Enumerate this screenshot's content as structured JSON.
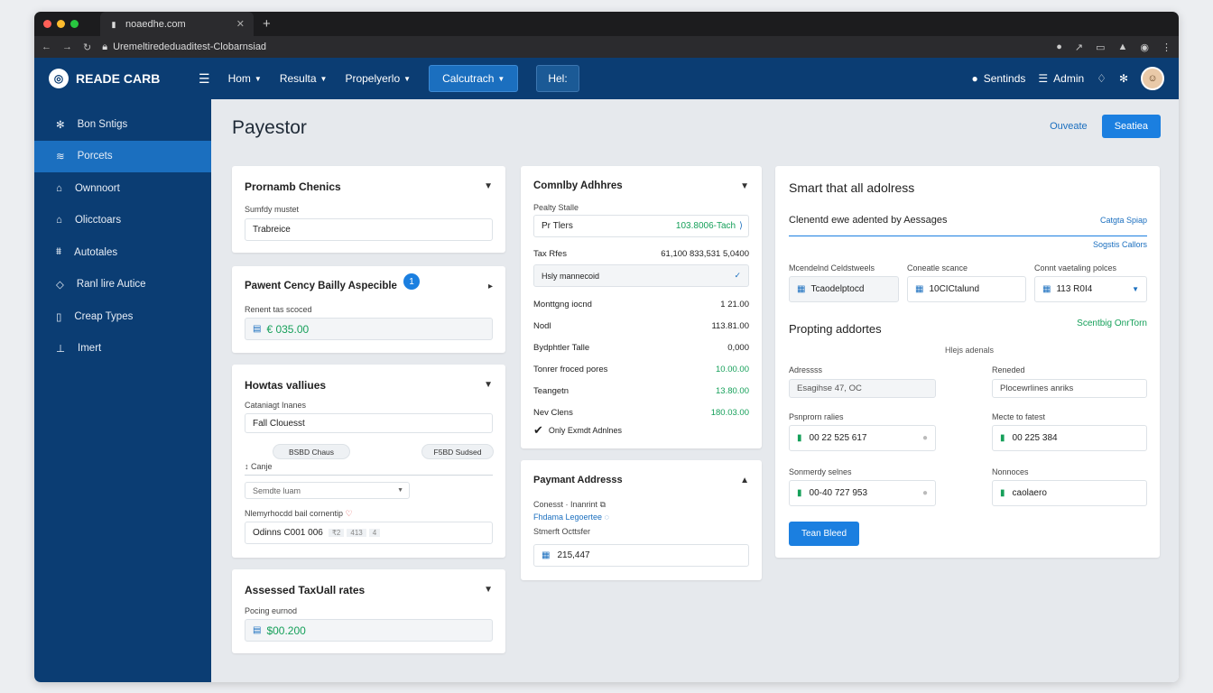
{
  "browser": {
    "tab_title": "noaedhe.com",
    "url": "Uremeltirededuaditest-Clobarnsiad",
    "new_tab": "+"
  },
  "app": {
    "brand": "READE CARB",
    "nav": [
      {
        "label": "Hom"
      },
      {
        "label": "Resulta"
      },
      {
        "label": "Propelyerlo"
      }
    ],
    "nav_button": "Calcutrach",
    "nav_button2": "Hel:",
    "settings": "Sentinds",
    "admin": "Admin"
  },
  "sidebar": {
    "items": [
      {
        "label": "Bon Sntigs",
        "icon": "gear-icon"
      },
      {
        "label": "Porcets",
        "icon": "layers-icon"
      },
      {
        "label": "Ownnoort",
        "icon": "home-icon"
      },
      {
        "label": "Olicctoars",
        "icon": "building-icon"
      },
      {
        "label": "Autotales",
        "icon": "bank-icon"
      },
      {
        "label": "Ranl lire Autice",
        "icon": "tag-icon"
      },
      {
        "label": "Creap Types",
        "icon": "document-icon"
      },
      {
        "label": "Imert",
        "icon": "import-icon"
      }
    ]
  },
  "page": {
    "title": "Payestor",
    "link": "Ouveate",
    "primary": "Seatiea"
  },
  "col1": {
    "c1": {
      "title": "Prornamb Chenics",
      "label": "Sumfdy mustet",
      "value": "Trabreice"
    },
    "c2": {
      "title": "Pawent Cency Bailly Aspecible",
      "badge": "1",
      "label": "Renent tas scoced",
      "value": "€ 035.00"
    },
    "c3": {
      "title": "Howtas valliues",
      "label1": "Cataniagt Inanes",
      "value1": "Fall Clouesst",
      "pill1": "BSBD Chaus",
      "pill2": "F5BD Sudsed",
      "label2": "Canje",
      "select": "Semdte luam",
      "label3": "Nlemyrhocdd bail cornentip",
      "value3": "Odinns C001 006",
      "tag1": "₹2",
      "tag2": "413",
      "tag3": "4"
    },
    "c4": {
      "title": "Assessed TaxUall rates",
      "label": "Pocing eurnod",
      "value": "$00.200"
    }
  },
  "col2": {
    "c1": {
      "title": "Comnlby Adhhres",
      "label": "Pealty Stalle",
      "field_left": "Pr Tlers",
      "field_right": "103.8006-Tach",
      "tax_label": "Tax Rfes",
      "tax_value": "61,100 833,531 5,0400",
      "select": "Hsly mannecoid",
      "rows": [
        {
          "k": "Monttgng iocnd",
          "v": "1 21.00"
        },
        {
          "k": "Nodl",
          "v": "113.81.00"
        },
        {
          "k": "Bydphtler Talle",
          "v": "0,000"
        },
        {
          "k": "Tonrer froced pores",
          "v": "10.00.00"
        },
        {
          "k": "Teangetn",
          "v": "13.80.00"
        },
        {
          "k": "Nev Clens",
          "v": "180.03.00"
        }
      ],
      "check": "Only Exmdt Adnlnes"
    },
    "c2": {
      "title": "Paymant Addresss",
      "line1": "Conesst · Inanrint",
      "line2": "Fhdama Legoertee",
      "label": "Stmerft Octtsfer",
      "value": "215,447"
    }
  },
  "col3": {
    "title": "Smart that all adolress",
    "subtitle": "Clenentd ewe adented by Aessages",
    "link1": "Catgta Spiap",
    "link2": "Sogstis Callors",
    "fields": [
      {
        "label": "Mcendelnd Celdstweels",
        "value": "Tcaodelptocd"
      },
      {
        "label": "Coneatle scance",
        "value": "10CICtalund"
      },
      {
        "label": "Connt vaetaling polces",
        "value": "113 R0I4"
      }
    ],
    "section": "Propting addortes",
    "section_link": "Scentbig OnrTorn",
    "center_label": "Hlejs adenals",
    "addr_label": "Adressss",
    "addr_value": "Esagihse 47, OC",
    "recv_label": "Reneded",
    "recv_value": "Plocewrlines anriks",
    "pay_label": "Psnprorn ralies",
    "pay_value": "00 22 525 617",
    "make_label": "Mecte to fatest",
    "make_value": "00 225 384",
    "sec_label": "Sonmerdy selnes",
    "sec_value": "00-40 727 953",
    "note_label": "Nonnoces",
    "note_value": "caolaero",
    "button": "Tean Bleed"
  }
}
